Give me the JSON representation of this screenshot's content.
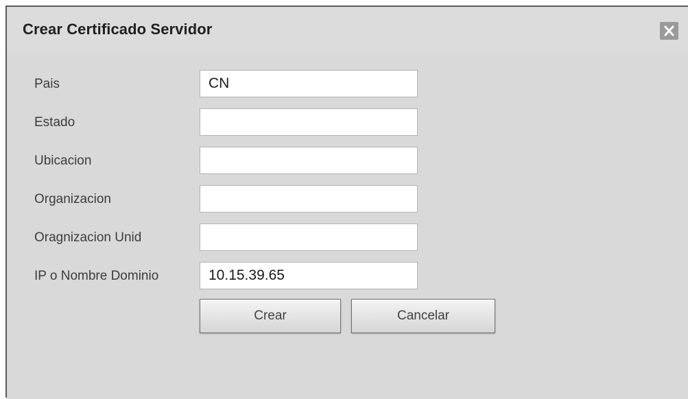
{
  "dialog": {
    "title": "Crear Certificado Servidor",
    "close_icon": "close-icon"
  },
  "form": {
    "fields": [
      {
        "label": "Pais",
        "value": "CN",
        "placeholder": ""
      },
      {
        "label": "Estado",
        "value": "",
        "placeholder": ""
      },
      {
        "label": "Ubicacion",
        "value": "",
        "placeholder": ""
      },
      {
        "label": "Organizacion",
        "value": "",
        "placeholder": ""
      },
      {
        "label": "Oragnizacion Unid",
        "value": "",
        "placeholder": ""
      },
      {
        "label": "IP o Nombre Dominio",
        "value": "10.15.39.65",
        "placeholder": ""
      }
    ]
  },
  "buttons": {
    "create_label": "Crear",
    "cancel_label": "Cancelar"
  },
  "colors": {
    "dialog_background": "#d9d9d9",
    "close_button": "#9a9a9a",
    "field_border": "#b3b3b3"
  }
}
